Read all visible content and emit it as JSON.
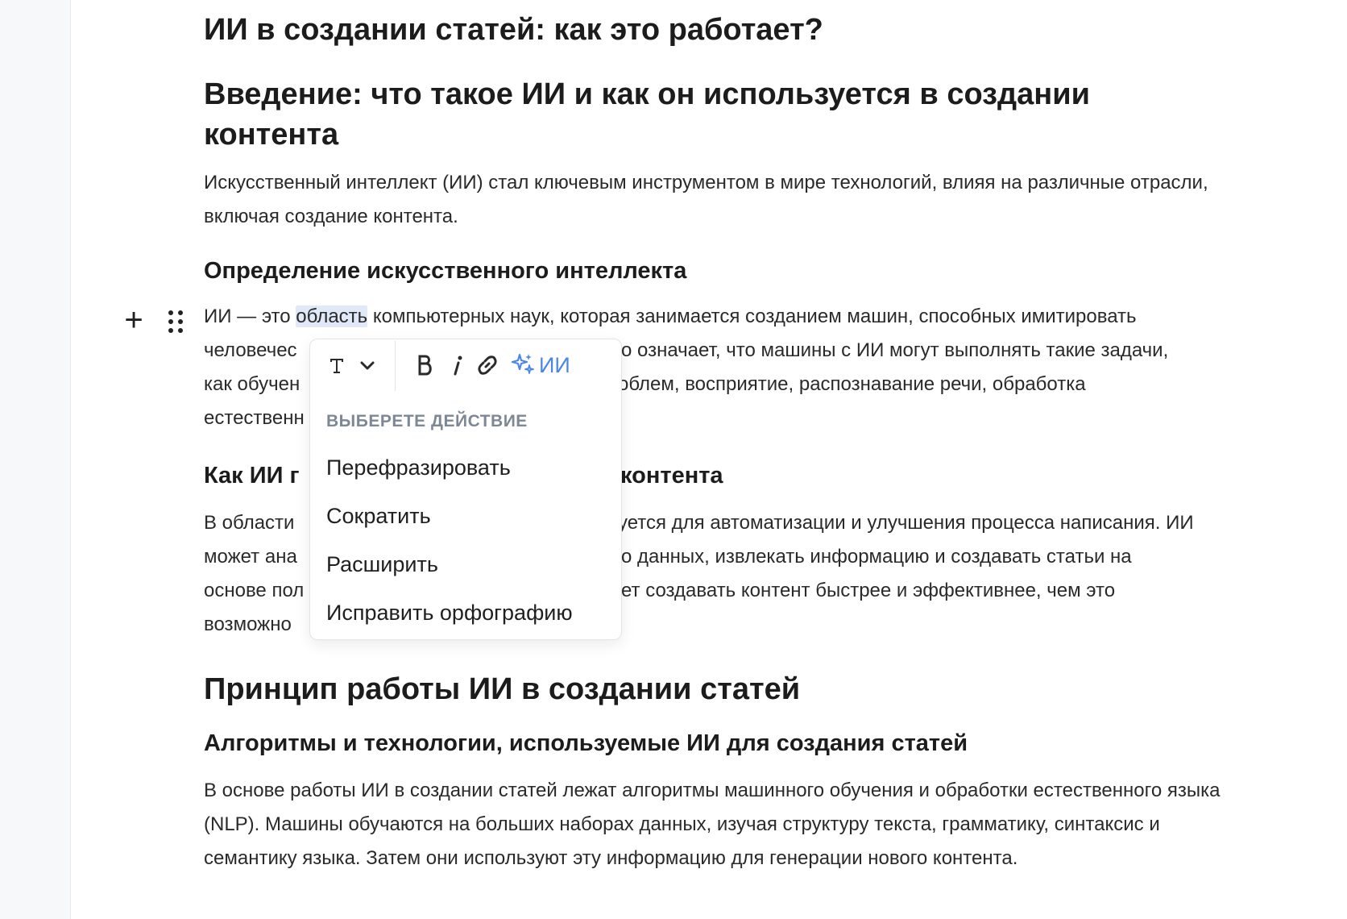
{
  "document": {
    "title": "ИИ в создании статей: как это работает?",
    "intro_heading": "Введение: что такое ИИ и как он используется в создании контента",
    "intro_paragraph": "Искусственный интеллект (ИИ) стал ключевым инструментом в мире технологий, влияя на различные отрасли, включая создание контента.",
    "definition_heading": "Определение искусственного интеллекта",
    "definition_paragraph": {
      "line1_before": "ИИ — это ",
      "line1_selected": "область",
      "line1_after": " компьютерных наук, которая занимается созданием машин, способных имитировать",
      "line2_left": "человечес",
      "line2_right": "о означает, что машины с ИИ могут выполнять такие задачи,",
      "line3_left": "как обучен",
      "line3_right": "облем, восприятие, распознавание речи, обработка",
      "line4_left": "естественн"
    },
    "usage_heading": {
      "left": "Как ИИ г",
      "right": "контента"
    },
    "usage_paragraph": {
      "line1_left": "В области",
      "line1_right": "уется для автоматизации и улучшения процесса написания. ИИ",
      "line2_left": "может ана",
      "line2_right": "о данных, извлекать информацию и создавать статьи на",
      "line3_left": "основе пол",
      "line3_right": "ет создавать контент быстрее и эффективнее, чем это",
      "line4_left": "возможно"
    },
    "principle_heading": "Принцип работы ИИ в создании статей",
    "algorithms_heading": "Алгоритмы и технологии, используемые ИИ для создания статей",
    "algorithms_paragraph": "В основе работы ИИ в создании статей лежат алгоритмы машинного обучения и обработки естественного языка (NLP). Машины обучаются на больших наборах данных, изучая структуру текста, грамматику, синтаксис и семантику языка. Затем они используют эту информацию для генерации нового контента."
  },
  "block_controls": {
    "add_icon": "plus-icon",
    "drag_icon": "drag-handle-icon"
  },
  "popup": {
    "toolbar": {
      "text_style_icon": "text-type-icon",
      "dropdown_icon": "chevron-down-icon",
      "bold_icon": "bold-icon",
      "italic_icon": "italic-icon",
      "link_icon": "link-icon",
      "ai_icon": "sparkles-icon",
      "ai_label": "ИИ"
    },
    "menu_header": "ВЫБЕРЕТЕ ДЕЙСТВИЕ",
    "items": [
      "Перефразировать",
      "Сократить",
      "Расширить",
      "Исправить орфографию"
    ]
  },
  "colors": {
    "accent": "#4a86e8",
    "selection": "#dfe9f8",
    "muted": "#7d8896"
  }
}
